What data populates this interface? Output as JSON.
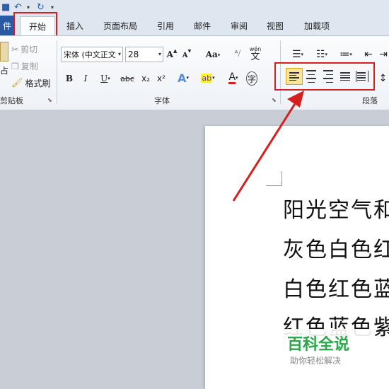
{
  "tabs": {
    "file": "件",
    "home": "开始",
    "insert": "插入",
    "page_layout": "页面布局",
    "references": "引用",
    "mailings": "邮件",
    "review": "审阅",
    "view": "视图",
    "addins": "加载项"
  },
  "clipboard": {
    "paste_fragment": "占",
    "cut": "剪切",
    "copy": "复制",
    "format_painter": "格式刷",
    "group_label": "剪贴板"
  },
  "font": {
    "name": "宋体 (中文正文",
    "size": "28",
    "group_label": "字体",
    "grow": "A",
    "shrink": "A",
    "change_case": "Aa",
    "bold": "B",
    "italic": "I",
    "underline": "U",
    "strike": "abc",
    "subscript": "x₂",
    "superscript": "x²",
    "wen": "wén",
    "wen_char": "文"
  },
  "paragraph": {
    "group_label": "段落"
  },
  "document": {
    "lines": [
      "阳光空气和",
      "灰色白色红",
      "白色红色蓝",
      "红色蓝色紫"
    ]
  },
  "watermark": {
    "title": "百科全说",
    "subtitle": "助你轻松解决"
  },
  "colors": {
    "accent_red": "#d61f1f",
    "file_blue": "#2a5aa3",
    "watermark_green": "#2aa84a"
  }
}
